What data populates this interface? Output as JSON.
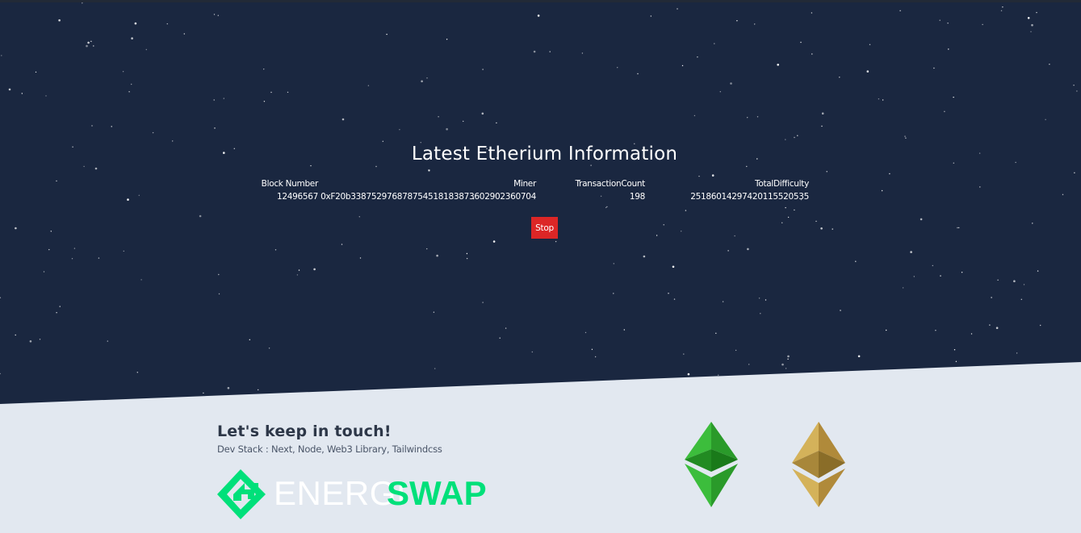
{
  "hero": {
    "title": "Latest Etherium Information"
  },
  "block_table": {
    "headers": [
      "Block Number",
      "Miner",
      "TransactionCount",
      "TotalDifficulty"
    ],
    "row": [
      "12496567",
      "0xF20b338752976878754518183873602902360704",
      "198",
      "25186014297420115520535"
    ]
  },
  "stop_button": {
    "label": "Stop",
    "color": "#dc2626"
  },
  "footer": {
    "heading": "Let's keep in touch!",
    "dev_stack": "Dev Stack : Next, Node, Web3 Library, Tailwindcss",
    "logo": {
      "text_left": "ENERGI",
      "text_right": "SWAP",
      "accent": "#00e07a"
    }
  },
  "icons": [
    "ethereum-classic-icon",
    "ethereum-icon"
  ],
  "colors": {
    "sky": "#1a2740",
    "footer_bg": "#e2e8f0",
    "etc_green": "#2fae2f",
    "eth_gold": "#c8a14a"
  }
}
